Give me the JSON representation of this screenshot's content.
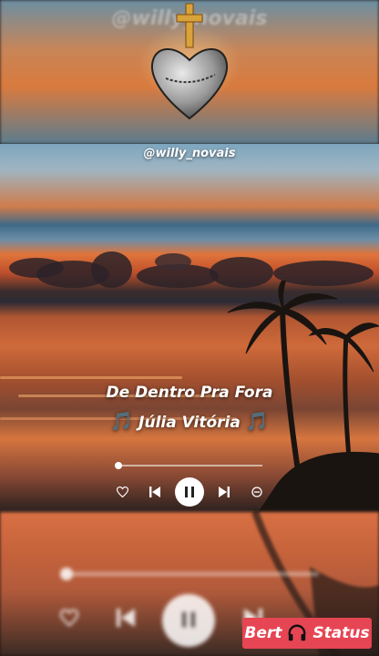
{
  "watermark": {
    "top_text": "@willy_novais"
  },
  "username": "@willy_novais",
  "song": {
    "title": "De Dentro Pra Fora",
    "artist": "Júlia Vitória",
    "note_glyph": "🎵"
  },
  "player": {
    "progress": 0.0,
    "controls": [
      "heart-icon",
      "previous-icon",
      "pause-icon",
      "next-icon",
      "minus-circle-icon"
    ]
  },
  "brand": {
    "label_left": "Bert",
    "label_right": "Status",
    "icon": "headphones-icon",
    "color": "#e64553"
  },
  "colors": {
    "accent_note": "#9b3cf2"
  }
}
